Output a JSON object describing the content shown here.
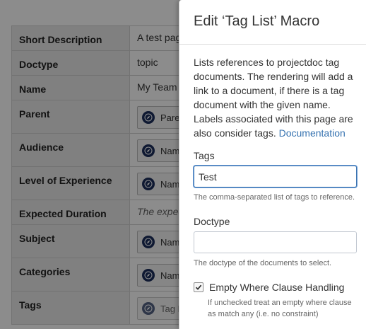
{
  "properties": [
    {
      "label": "Short Description",
      "value": "A test page",
      "kind": "text"
    },
    {
      "label": "Doctype",
      "value": "topic",
      "kind": "text"
    },
    {
      "label": "Name",
      "value": "My Team",
      "kind": "text"
    },
    {
      "label": "Parent",
      "value": "Paren",
      "kind": "ref"
    },
    {
      "label": "Audience",
      "value": "Name",
      "kind": "ref"
    },
    {
      "label": "Level of Experience",
      "value": "Name",
      "kind": "ref"
    },
    {
      "label": "Expected Duration",
      "value": "The expect",
      "kind": "italic"
    },
    {
      "label": "Subject",
      "value": "Name",
      "kind": "ref"
    },
    {
      "label": "Categories",
      "value": "Name",
      "kind": "ref"
    },
    {
      "label": "Tags",
      "value": "Tag Li",
      "kind": "ref-muted"
    }
  ],
  "dialog": {
    "title": "Edit ‘Tag List’ Macro",
    "description": "Lists references to projectdoc tag documents. The rendering will add a link to a document, if there is a tag document with the given name. Labels associated with this page are also consider tags.",
    "doc_link": "Documentation",
    "tags": {
      "label": "Tags",
      "value": "Test",
      "help": "The comma-separated list of tags to reference."
    },
    "doctype": {
      "label": "Doctype",
      "value": "",
      "help": "The doctype of the documents to select."
    },
    "empty_where": {
      "label": "Empty Where Clause Handling",
      "checked": true,
      "help": "If unchecked treat an empty where clause as match any (i.e. no constraint)"
    }
  },
  "colors": {
    "link": "#3572b0",
    "focus_border": "#3b73af",
    "ref_icon": "#1d2f5c"
  },
  "icons": {
    "ref": "compass-icon",
    "checkbox": "checkmark-icon"
  }
}
